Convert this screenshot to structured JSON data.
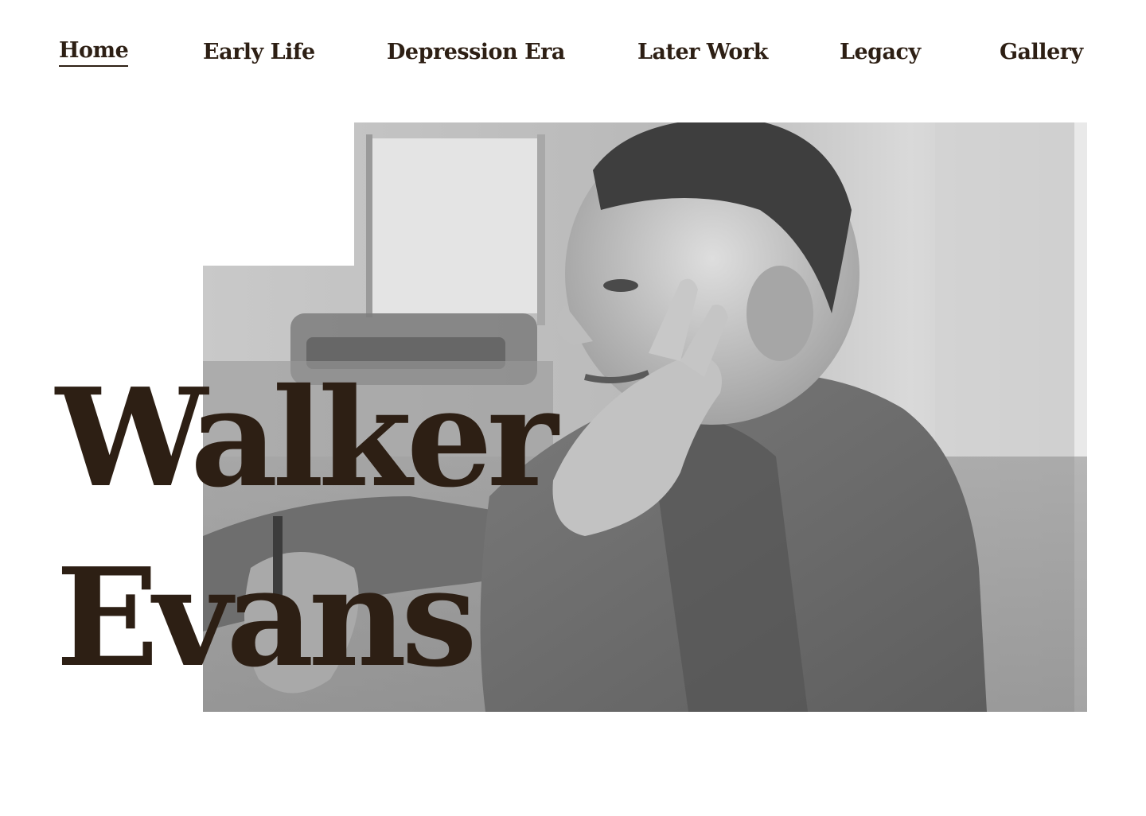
{
  "nav": {
    "items": [
      {
        "label": "Home",
        "active": true
      },
      {
        "label": "Early Life",
        "active": false
      },
      {
        "label": "Depression Era",
        "active": false
      },
      {
        "label": "Later Work",
        "active": false
      },
      {
        "label": "Legacy",
        "active": false
      },
      {
        "label": "Gallery",
        "active": false
      }
    ]
  },
  "hero": {
    "title_line1": "Walker",
    "title_line2": "Evans",
    "photo_icon": "portrait-photo",
    "photo_alt": "Walker Evans"
  },
  "colors": {
    "text": "#2d1f14",
    "background": "#ffffff",
    "photo_tone": "#8a8a8a"
  }
}
